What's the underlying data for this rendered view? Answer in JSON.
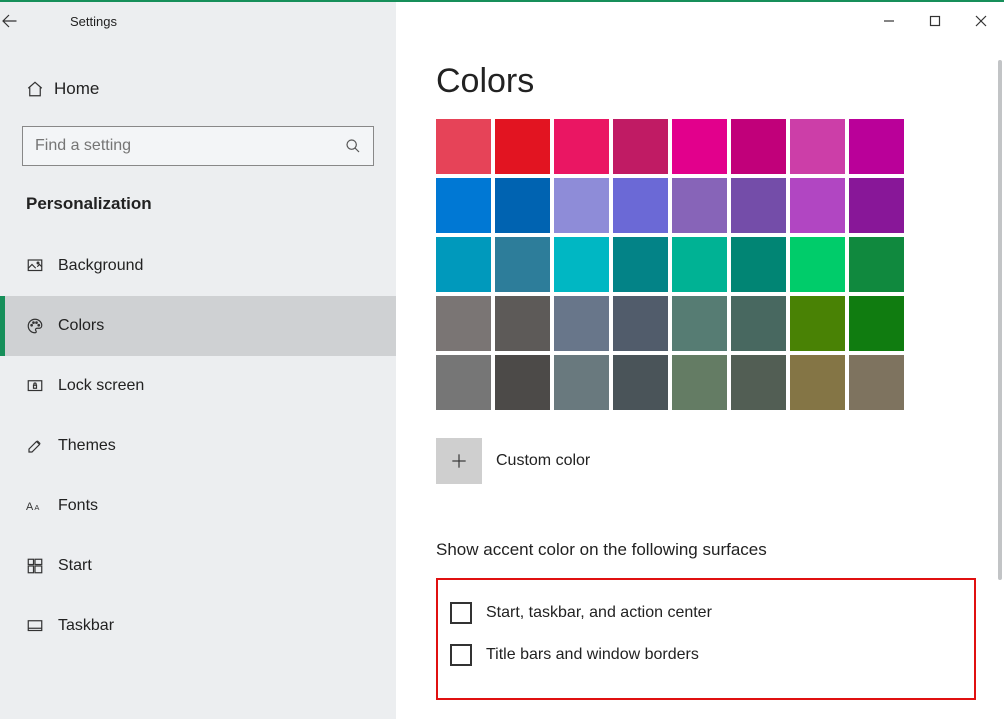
{
  "titlebar": {
    "title": "Settings"
  },
  "sidebar": {
    "home": "Home",
    "search_placeholder": "Find a setting",
    "section": "Personalization",
    "items": [
      {
        "id": "background",
        "label": "Background"
      },
      {
        "id": "colors",
        "label": "Colors"
      },
      {
        "id": "lockscreen",
        "label": "Lock screen"
      },
      {
        "id": "themes",
        "label": "Themes"
      },
      {
        "id": "fonts",
        "label": "Fonts"
      },
      {
        "id": "start",
        "label": "Start"
      },
      {
        "id": "taskbar",
        "label": "Taskbar"
      }
    ],
    "active": "colors"
  },
  "main": {
    "title": "Colors",
    "swatches": [
      "#e64358",
      "#e21421",
      "#ea1663",
      "#c01b64",
      "#e2008c",
      "#c1007a",
      "#cc3ea8",
      "#ba0099",
      "#0078d4",
      "#0063b1",
      "#8e8cd8",
      "#6b69d6",
      "#8764b8",
      "#744da9",
      "#b146c2",
      "#881798",
      "#0099bc",
      "#2d7d9a",
      "#00b7c3",
      "#038387",
      "#00b294",
      "#018574",
      "#00cc6a",
      "#10893e",
      "#7a7574",
      "#5d5a58",
      "#68768a",
      "#515c6b",
      "#567c73",
      "#486860",
      "#498205",
      "#107c10",
      "#767676",
      "#4c4a48",
      "#69797e",
      "#4a5459",
      "#647c64",
      "#525e54",
      "#847545",
      "#7e735f"
    ],
    "custom_label": "Custom color",
    "subhead": "Show accent color on the following surfaces",
    "checks": [
      {
        "id": "start-taskbar",
        "label": "Start, taskbar, and action center",
        "checked": false
      },
      {
        "id": "title-bars",
        "label": "Title bars and window borders",
        "checked": false
      }
    ]
  }
}
